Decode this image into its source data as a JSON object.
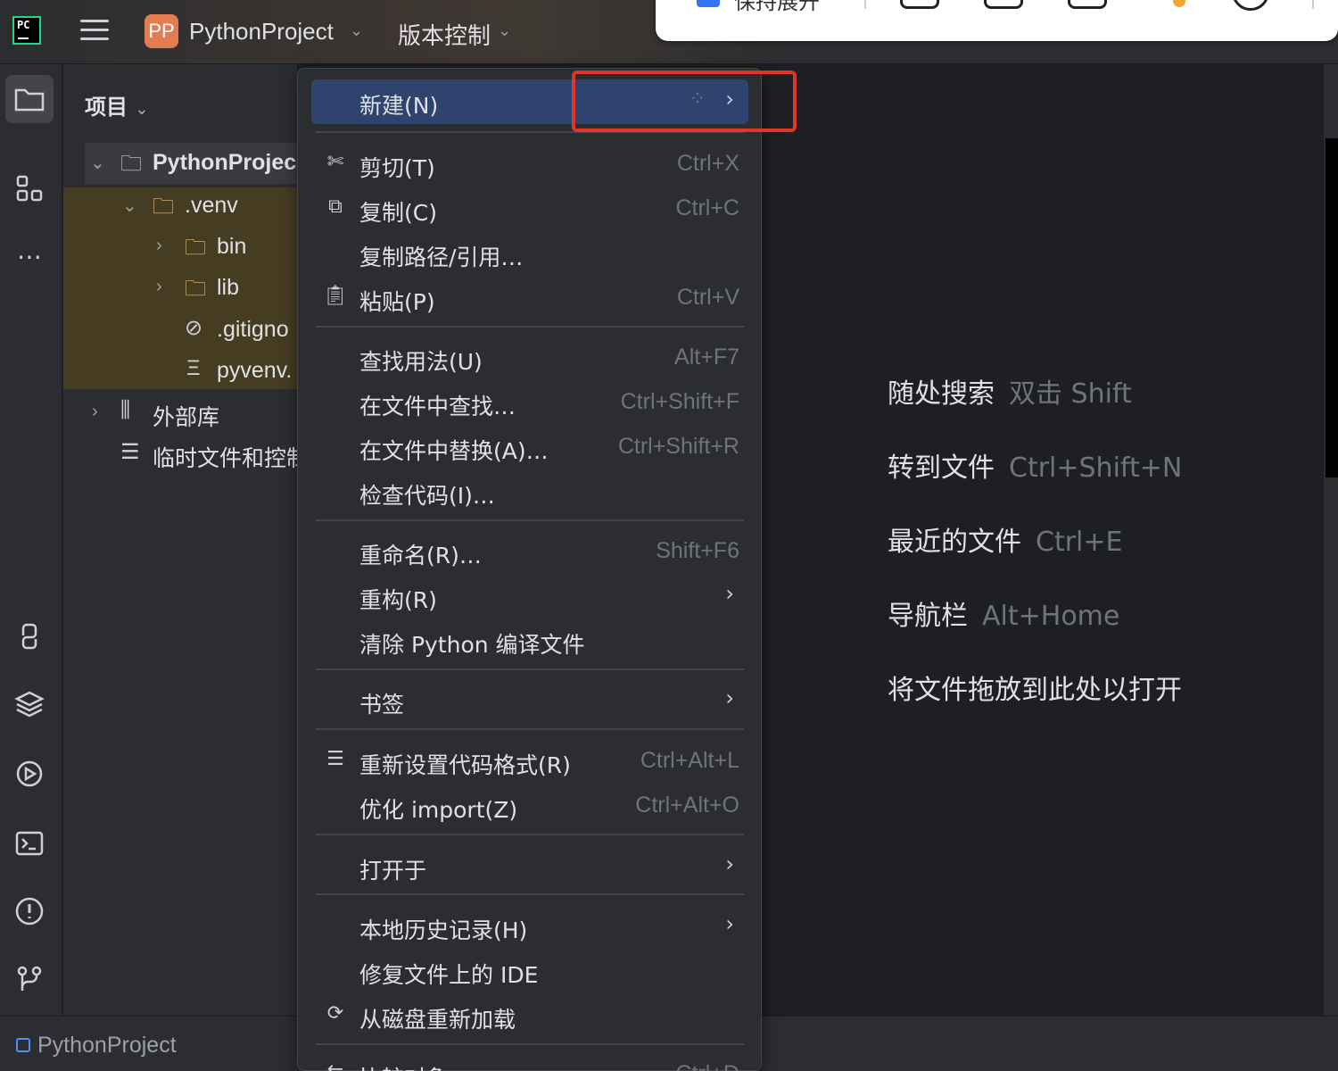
{
  "titlebar": {
    "logo": "PC",
    "project_badge": "PP",
    "project_name": "PythonProject",
    "vcs_label": "版本控制"
  },
  "float_toolbar": {
    "keep_expanded_label": "保持展开",
    "colors": {
      "checkbox": "#3574f0",
      "notification_dot": "#f4a630"
    }
  },
  "project_panel": {
    "title": "项目",
    "tree": [
      {
        "label": "PythonProjec",
        "icon": "folder-icon",
        "expanded": true
      },
      {
        "label": ".venv",
        "icon": "folder-icon",
        "expanded": true
      },
      {
        "label": "bin",
        "icon": "folder-icon",
        "expanded": false
      },
      {
        "label": "lib",
        "icon": "folder-icon",
        "expanded": false
      },
      {
        "label": ".gitigno",
        "icon": "ignore-file-icon"
      },
      {
        "label": "pyvenv.",
        "icon": "config-file-icon"
      },
      {
        "label": "外部库",
        "icon": "library-icon",
        "expanded": false
      },
      {
        "label": "临时文件和控制",
        "icon": "scratch-icon"
      }
    ]
  },
  "context_menu": {
    "items": [
      {
        "label": "新建(N)",
        "submenu": true,
        "selected": true,
        "loading": true
      },
      {
        "label": "剪切(T)",
        "shortcut": "Ctrl+X",
        "icon": "scissors-icon"
      },
      {
        "label": "复制(C)",
        "shortcut": "Ctrl+C",
        "icon": "copy-icon"
      },
      {
        "label": "复制路径/引用…"
      },
      {
        "label": "粘贴(P)",
        "shortcut": "Ctrl+V",
        "icon": "paste-icon"
      },
      {
        "label": "查找用法(U)",
        "shortcut": "Alt+F7"
      },
      {
        "label": "在文件中查找…",
        "shortcut": "Ctrl+Shift+F"
      },
      {
        "label": "在文件中替换(A)…",
        "shortcut": "Ctrl+Shift+R"
      },
      {
        "label": "检查代码(I)…"
      },
      {
        "label": "重命名(R)…",
        "shortcut": "Shift+F6"
      },
      {
        "label": "重构(R)",
        "submenu": true
      },
      {
        "label": "清除 Python 编译文件"
      },
      {
        "label": "书签",
        "submenu": true
      },
      {
        "label": "重新设置代码格式(R)",
        "shortcut": "Ctrl+Alt+L",
        "icon": "reformat-icon"
      },
      {
        "label": "优化 import(Z)",
        "shortcut": "Ctrl+Alt+O"
      },
      {
        "label": "打开于",
        "submenu": true
      },
      {
        "label": "本地历史记录(H)",
        "submenu": true
      },
      {
        "label": "修复文件上的 IDE"
      },
      {
        "label": "从磁盘重新加载",
        "icon": "reload-icon"
      },
      {
        "label": "比较对象",
        "shortcut": "Ctrl+D",
        "icon": "compare-icon"
      }
    ]
  },
  "editor_hints": [
    {
      "label": "随处搜索",
      "key": "双击 Shift"
    },
    {
      "label": "转到文件",
      "key": "Ctrl+Shift+N"
    },
    {
      "label": "最近的文件",
      "key": "Ctrl+E"
    },
    {
      "label": "导航栏",
      "key": "Alt+Home"
    },
    {
      "label": "将文件拖放到此处以打开",
      "key": ""
    }
  ],
  "statusbar": {
    "project": "PythonProject"
  },
  "colors": {
    "background": "#1e1f22",
    "panel": "#2b2d30",
    "menu_selected": "#2e436e",
    "annotation_box": "#e0352b",
    "project_badge": "#e07e52"
  }
}
